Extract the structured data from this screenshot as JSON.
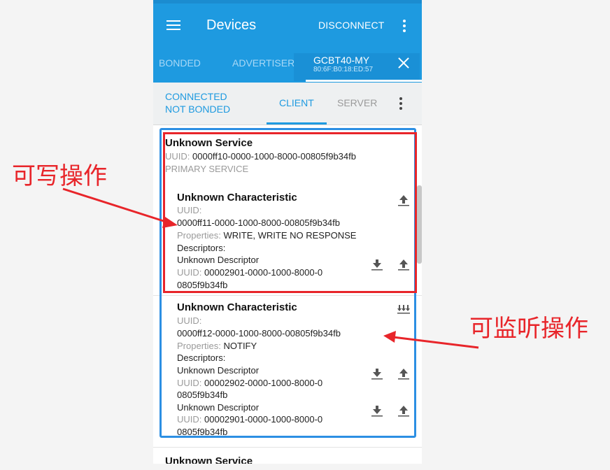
{
  "app": {
    "title": "Devices",
    "disconnect_label": "DISCONNECT"
  },
  "tabs": {
    "bonded": "BONDED",
    "advertiser": "ADVERTISER",
    "device_name": "GCBT40-MY",
    "device_mac": "80:6F:B0:18:ED:57"
  },
  "connection": {
    "state": "CONNECTED",
    "bond": "NOT BONDED",
    "client_tab": "CLIENT",
    "server_tab": "SERVER"
  },
  "service1": {
    "name": "Unknown Service",
    "uuid_label": "UUID:",
    "uuid": "0000ff10-0000-1000-8000-00805f9b34fb",
    "type": "PRIMARY SERVICE"
  },
  "char1": {
    "name": "Unknown Characteristic",
    "uuid_label": "UUID:",
    "uuid": "0000ff11-0000-1000-8000-00805f9b34fb",
    "props_label": "Properties:",
    "props": "WRITE, WRITE NO RESPONSE",
    "descriptors_label": "Descriptors:",
    "desc1_name": "Unknown Descriptor",
    "desc1_uuid_label": "UUID:",
    "desc1_uuid_a": "00002901-0000-1000-8000-0",
    "desc1_uuid_b": "0805f9b34fb"
  },
  "char2": {
    "name": "Unknown Characteristic",
    "uuid_label": "UUID:",
    "uuid": "0000ff12-0000-1000-8000-00805f9b34fb",
    "props_label": "Properties:",
    "props": "NOTIFY",
    "descriptors_label": "Descriptors:",
    "desc1_name": "Unknown Descriptor",
    "desc1_uuid_label": "UUID:",
    "desc1_uuid_a": "00002902-0000-1000-8000-0",
    "desc1_uuid_b": "0805f9b34fb",
    "desc2_name": "Unknown Descriptor",
    "desc2_uuid_label": "UUID:",
    "desc2_uuid_a": "00002901-0000-1000-8000-0",
    "desc2_uuid_b": "0805f9b34fb"
  },
  "service2": {
    "name": "Unknown Service"
  },
  "annotations": {
    "write": "可写操作",
    "notify": "可监听操作",
    "color": "#e8252a",
    "box_color": "#2c8fe3"
  },
  "icons": {
    "menu": "hamburger-icon",
    "more": "more-vert-icon",
    "close": "close-icon",
    "write": "upload-arrow-icon",
    "read": "download-arrow-icon",
    "notify": "notify-arrows-icon"
  },
  "colors": {
    "accent": "#1e9ae0",
    "accent_text": "#1e9ae0"
  }
}
